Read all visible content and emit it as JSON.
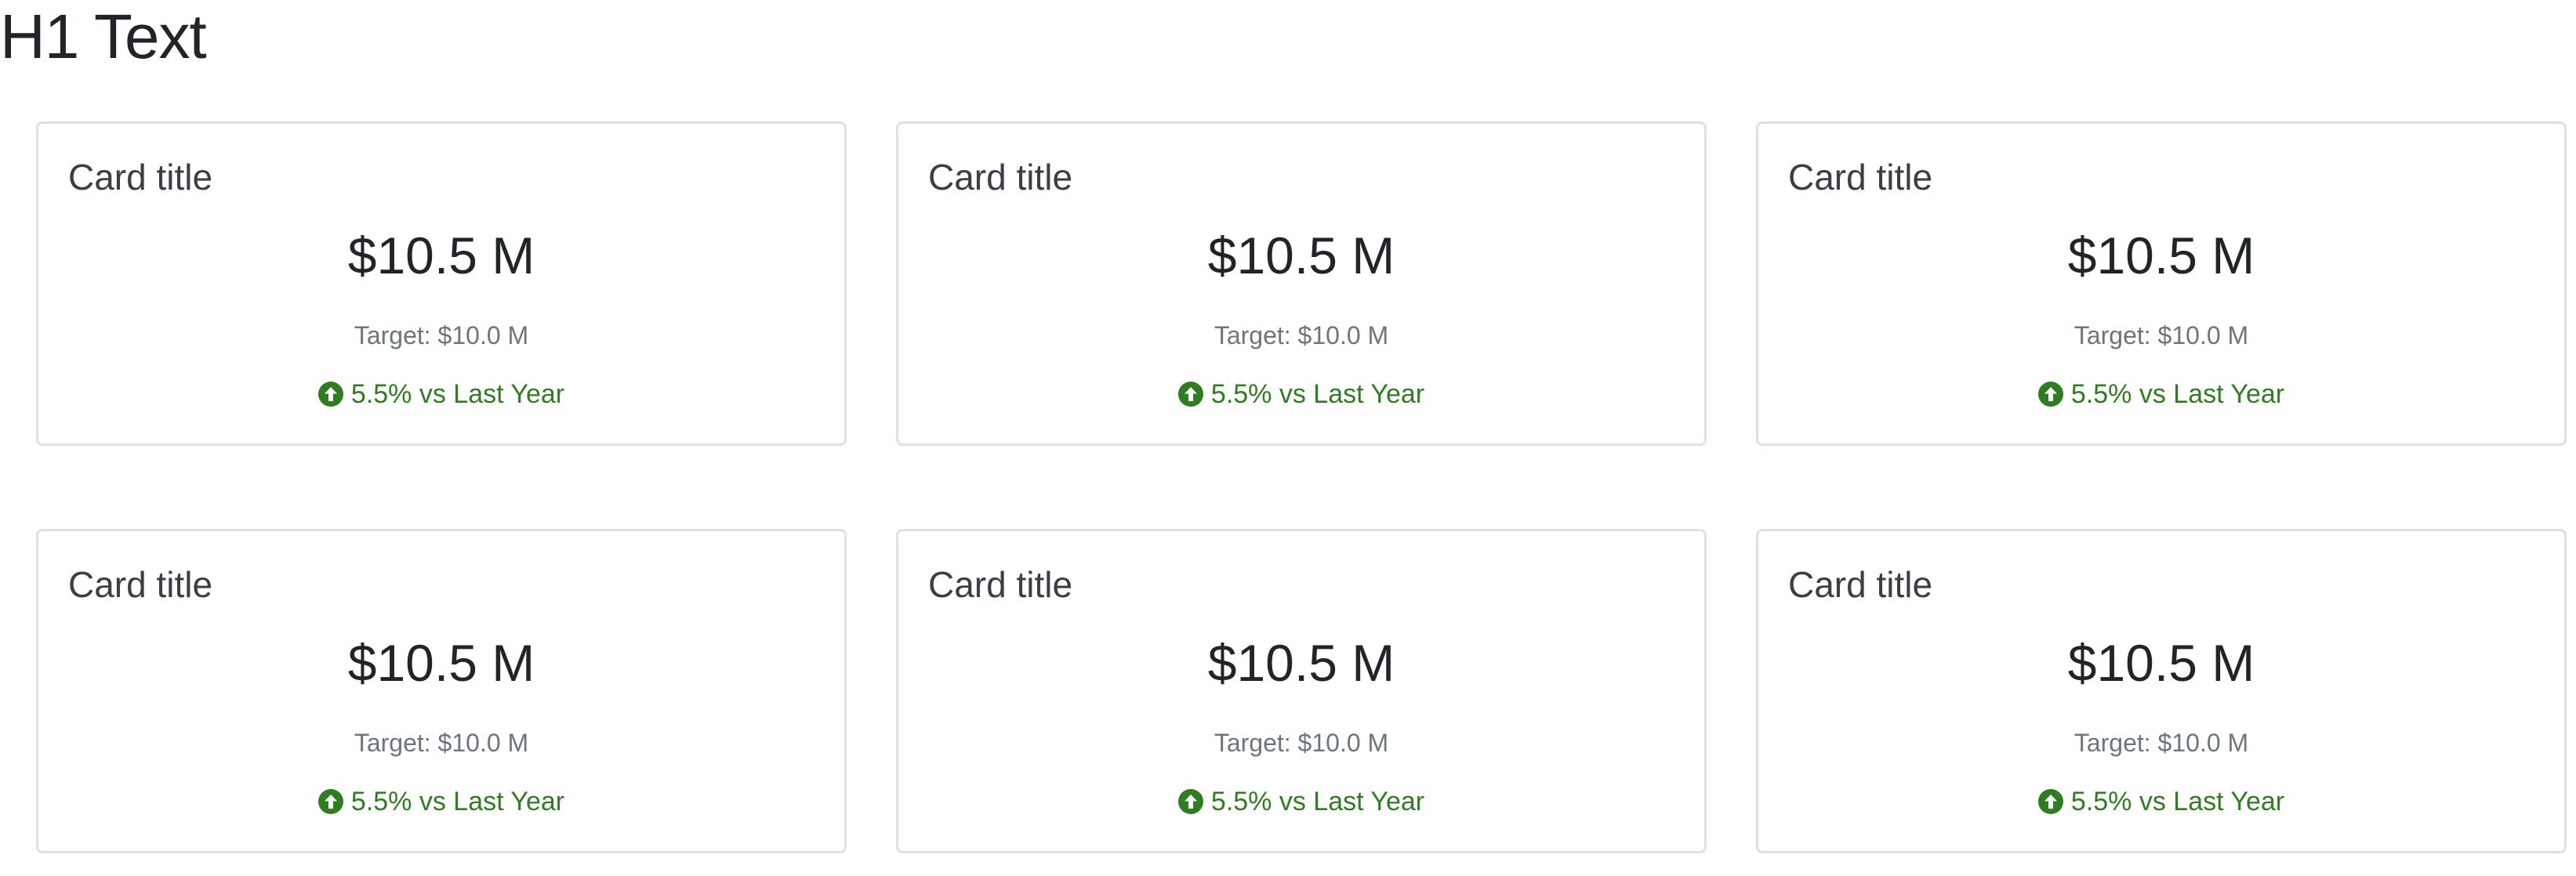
{
  "page": {
    "title": "H1 Text"
  },
  "colors": {
    "trend_positive": "#2e7d1f",
    "card_border": "#dfe1e5"
  },
  "cards": [
    {
      "title": "Card title",
      "value": "$10.5 M",
      "target": "Target: $10.0 M",
      "trend": "5.5% vs Last Year",
      "trend_icon": "arrow-up-circle-icon"
    },
    {
      "title": "Card title",
      "value": "$10.5 M",
      "target": "Target: $10.0 M",
      "trend": "5.5% vs Last Year",
      "trend_icon": "arrow-up-circle-icon"
    },
    {
      "title": "Card title",
      "value": "$10.5 M",
      "target": "Target: $10.0 M",
      "trend": "5.5% vs Last Year",
      "trend_icon": "arrow-up-circle-icon"
    },
    {
      "title": "Card title",
      "value": "$10.5 M",
      "target": "Target: $10.0 M",
      "trend": "5.5% vs Last Year",
      "trend_icon": "arrow-up-circle-icon"
    },
    {
      "title": "Card title",
      "value": "$10.5 M",
      "target": "Target: $10.0 M",
      "trend": "5.5% vs Last Year",
      "trend_icon": "arrow-up-circle-icon"
    },
    {
      "title": "Card title",
      "value": "$10.5 M",
      "target": "Target: $10.0 M",
      "trend": "5.5% vs Last Year",
      "trend_icon": "arrow-up-circle-icon"
    }
  ]
}
